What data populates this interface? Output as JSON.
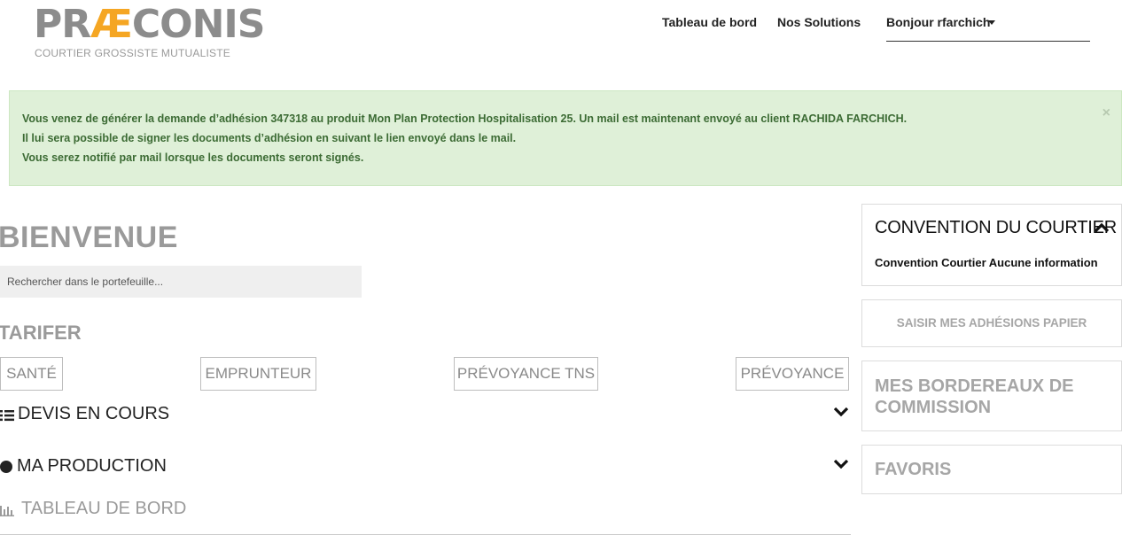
{
  "brand": {
    "name_part1": "PR",
    "name_part2": "Æ",
    "name_part3": "CONIS",
    "tagline": "COURTIER GROSSISTE MUTUALISTE",
    "colors": {
      "grey": "#8c8c8c",
      "orange": "#f5a623"
    }
  },
  "nav": {
    "dashboard": "Tableau de bord",
    "solutions": "Nos Solutions",
    "user_greeting": "Bonjour rfarchich"
  },
  "alert": {
    "line1": "Vous venez de générer la demande d’adhésion 347318 au produit Mon Plan Protection Hospitalisation 25. Un mail est maintenant envoyé au client RACHIDA FARCHICH.",
    "line2": "Il lui sera possible de signer les documents d’adhésion en suivant le lien envoyé dans le mail.",
    "line3": "Vous serez notifié par mail lorsque les documents seront signés.",
    "close": "×",
    "color": "#dff0d8"
  },
  "main": {
    "welcome": "BIENVENUE",
    "search_placeholder": "Rechercher dans le portefeuille...",
    "tarifer": "TARIFER",
    "tarif_buttons": [
      "SANTÉ",
      "EMPRUNTEUR",
      "PRÉVOYANCE TNS",
      "PRÉVOYANCE"
    ],
    "sections": {
      "devis": "DEVIS EN COURS",
      "production": "MA PRODUCTION",
      "dashboard": "TABLEAU DE BORD"
    }
  },
  "sidebar": {
    "convention_title": "CONVENTION DU COURTIER",
    "convention_text": "Convention Courtier Aucune information",
    "saisir": "SAISIR MES ADHÉSIONS PAPIER",
    "bordereaux": "MES BORDEREAUX DE COMMISSION",
    "favoris": "FAVORIS"
  },
  "icons": [
    "list-icon",
    "circle-icon",
    "bar-chart-icon",
    "chevron-down-icon",
    "chevron-up-icon",
    "caret-down-icon",
    "close-icon"
  ]
}
